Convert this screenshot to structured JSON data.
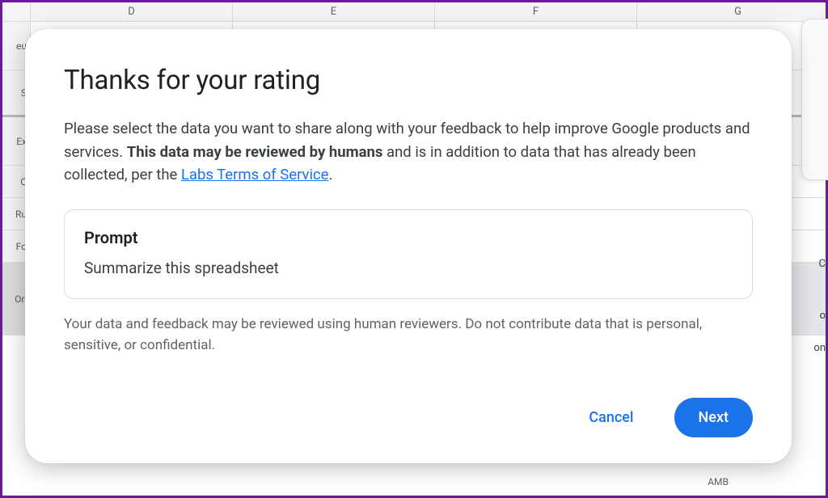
{
  "spreadsheet": {
    "columns": [
      "D",
      "E",
      "F",
      "G"
    ],
    "row_labels": [
      "eu",
      "S",
      "Ex",
      "C",
      "Ru",
      "Fo",
      "On"
    ],
    "fragment_right_1": "C",
    "fragment_right_2": "o",
    "fragment_right_3": "on",
    "bottom_label": "AMB"
  },
  "modal": {
    "title": "Thanks for your rating",
    "desc_part1": "Please select the data you want to share along with your feedback to help improve Google products and services. ",
    "desc_bold": "This data may be reviewed by humans",
    "desc_part2": " and is in addition to data that has already been collected, per the ",
    "link_text": "Labs Terms of Service",
    "desc_part3": ".",
    "prompt_label": "Prompt",
    "prompt_text": "Summarize this spreadsheet",
    "disclaimer": "Your data and feedback may be reviewed using human reviewers. Do not contribute data that is personal, sensitive, or confidential.",
    "cancel_label": "Cancel",
    "next_label": "Next"
  }
}
